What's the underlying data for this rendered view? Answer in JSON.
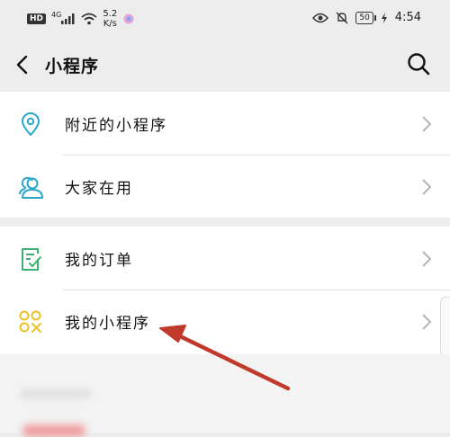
{
  "status_bar": {
    "hd": "HD",
    "network": "4G",
    "speed_value": "5.2",
    "speed_unit": "K/s",
    "battery": "50",
    "time": "4:54"
  },
  "header": {
    "title": "小程序"
  },
  "menu": {
    "nearby": {
      "label": "附近的小程序",
      "icon": "location-pin-icon"
    },
    "everyone": {
      "label": "大家在用",
      "icon": "users-icon"
    },
    "orders": {
      "label": "我的订单",
      "icon": "checklist-icon"
    },
    "mine": {
      "label": "我的小程序",
      "icon": "mini-program-icon"
    }
  },
  "colors": {
    "accent_cyan": "#2aa7c9",
    "accent_green": "#3bb273",
    "accent_yellow": "#e9c229",
    "annotation_red": "#c0392b"
  }
}
